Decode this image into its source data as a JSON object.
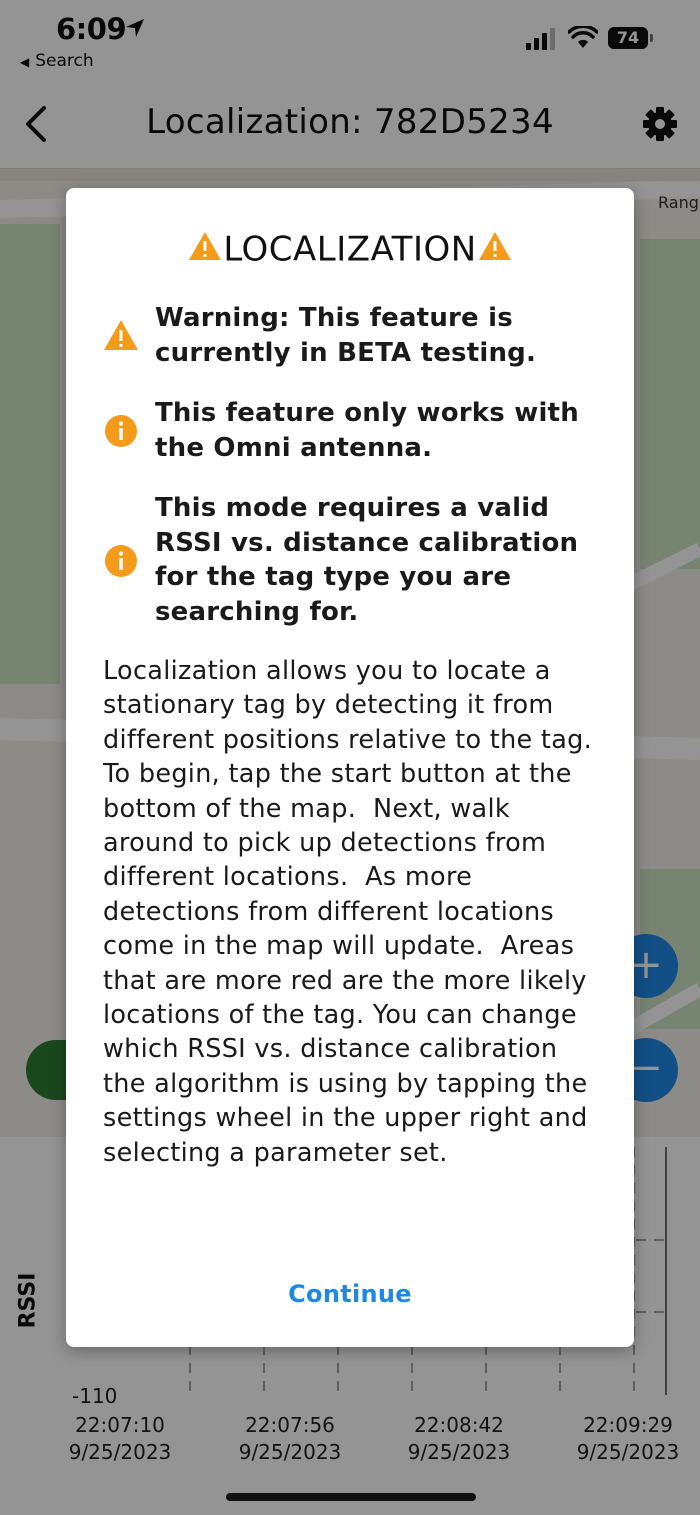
{
  "status_bar": {
    "time": "6:09",
    "back_app": "Search",
    "battery_level": "74"
  },
  "nav": {
    "title": "Localization: 782D5234"
  },
  "map": {
    "street_label": "Rang"
  },
  "chart_data": {
    "type": "line",
    "title": "",
    "ylabel": "RSSI",
    "yticks": [
      "-110"
    ],
    "x": [
      {
        "time": "22:07:10",
        "date": "9/25/2023"
      },
      {
        "time": "22:07:56",
        "date": "9/25/2023"
      },
      {
        "time": "22:08:42",
        "date": "9/25/2023"
      },
      {
        "time": "22:09:29",
        "date": "9/25/2023"
      }
    ],
    "series": []
  },
  "dialog": {
    "title": "LOCALIZATION",
    "notes": [
      {
        "icon": "warning-icon",
        "text": "Warning: This feature is currently in BETA testing."
      },
      {
        "icon": "info-icon",
        "text": "This feature only works with the Omni antenna."
      },
      {
        "icon": "info-icon",
        "text": "This mode requires a valid RSSI vs. distance calibration for the tag type you are searching for."
      }
    ],
    "body": "Localization allows you to locate a stationary tag by detecting it from different positions relative to the tag.  To begin, tap the start button at the bottom of the map.  Next, walk around to pick up detections from different locations.  As more detections from different locations come in the map will update.  Areas that are more red are the more likely locations of the tag. You can change which RSSI vs. distance calibration the algorithm is using by tapping the settings wheel in the upper right and selecting a parameter set.",
    "continue_label": "Continue"
  },
  "colors": {
    "accent": "#1e88e5",
    "warning": "#f59b1c",
    "start_button": "#2e7d32"
  }
}
